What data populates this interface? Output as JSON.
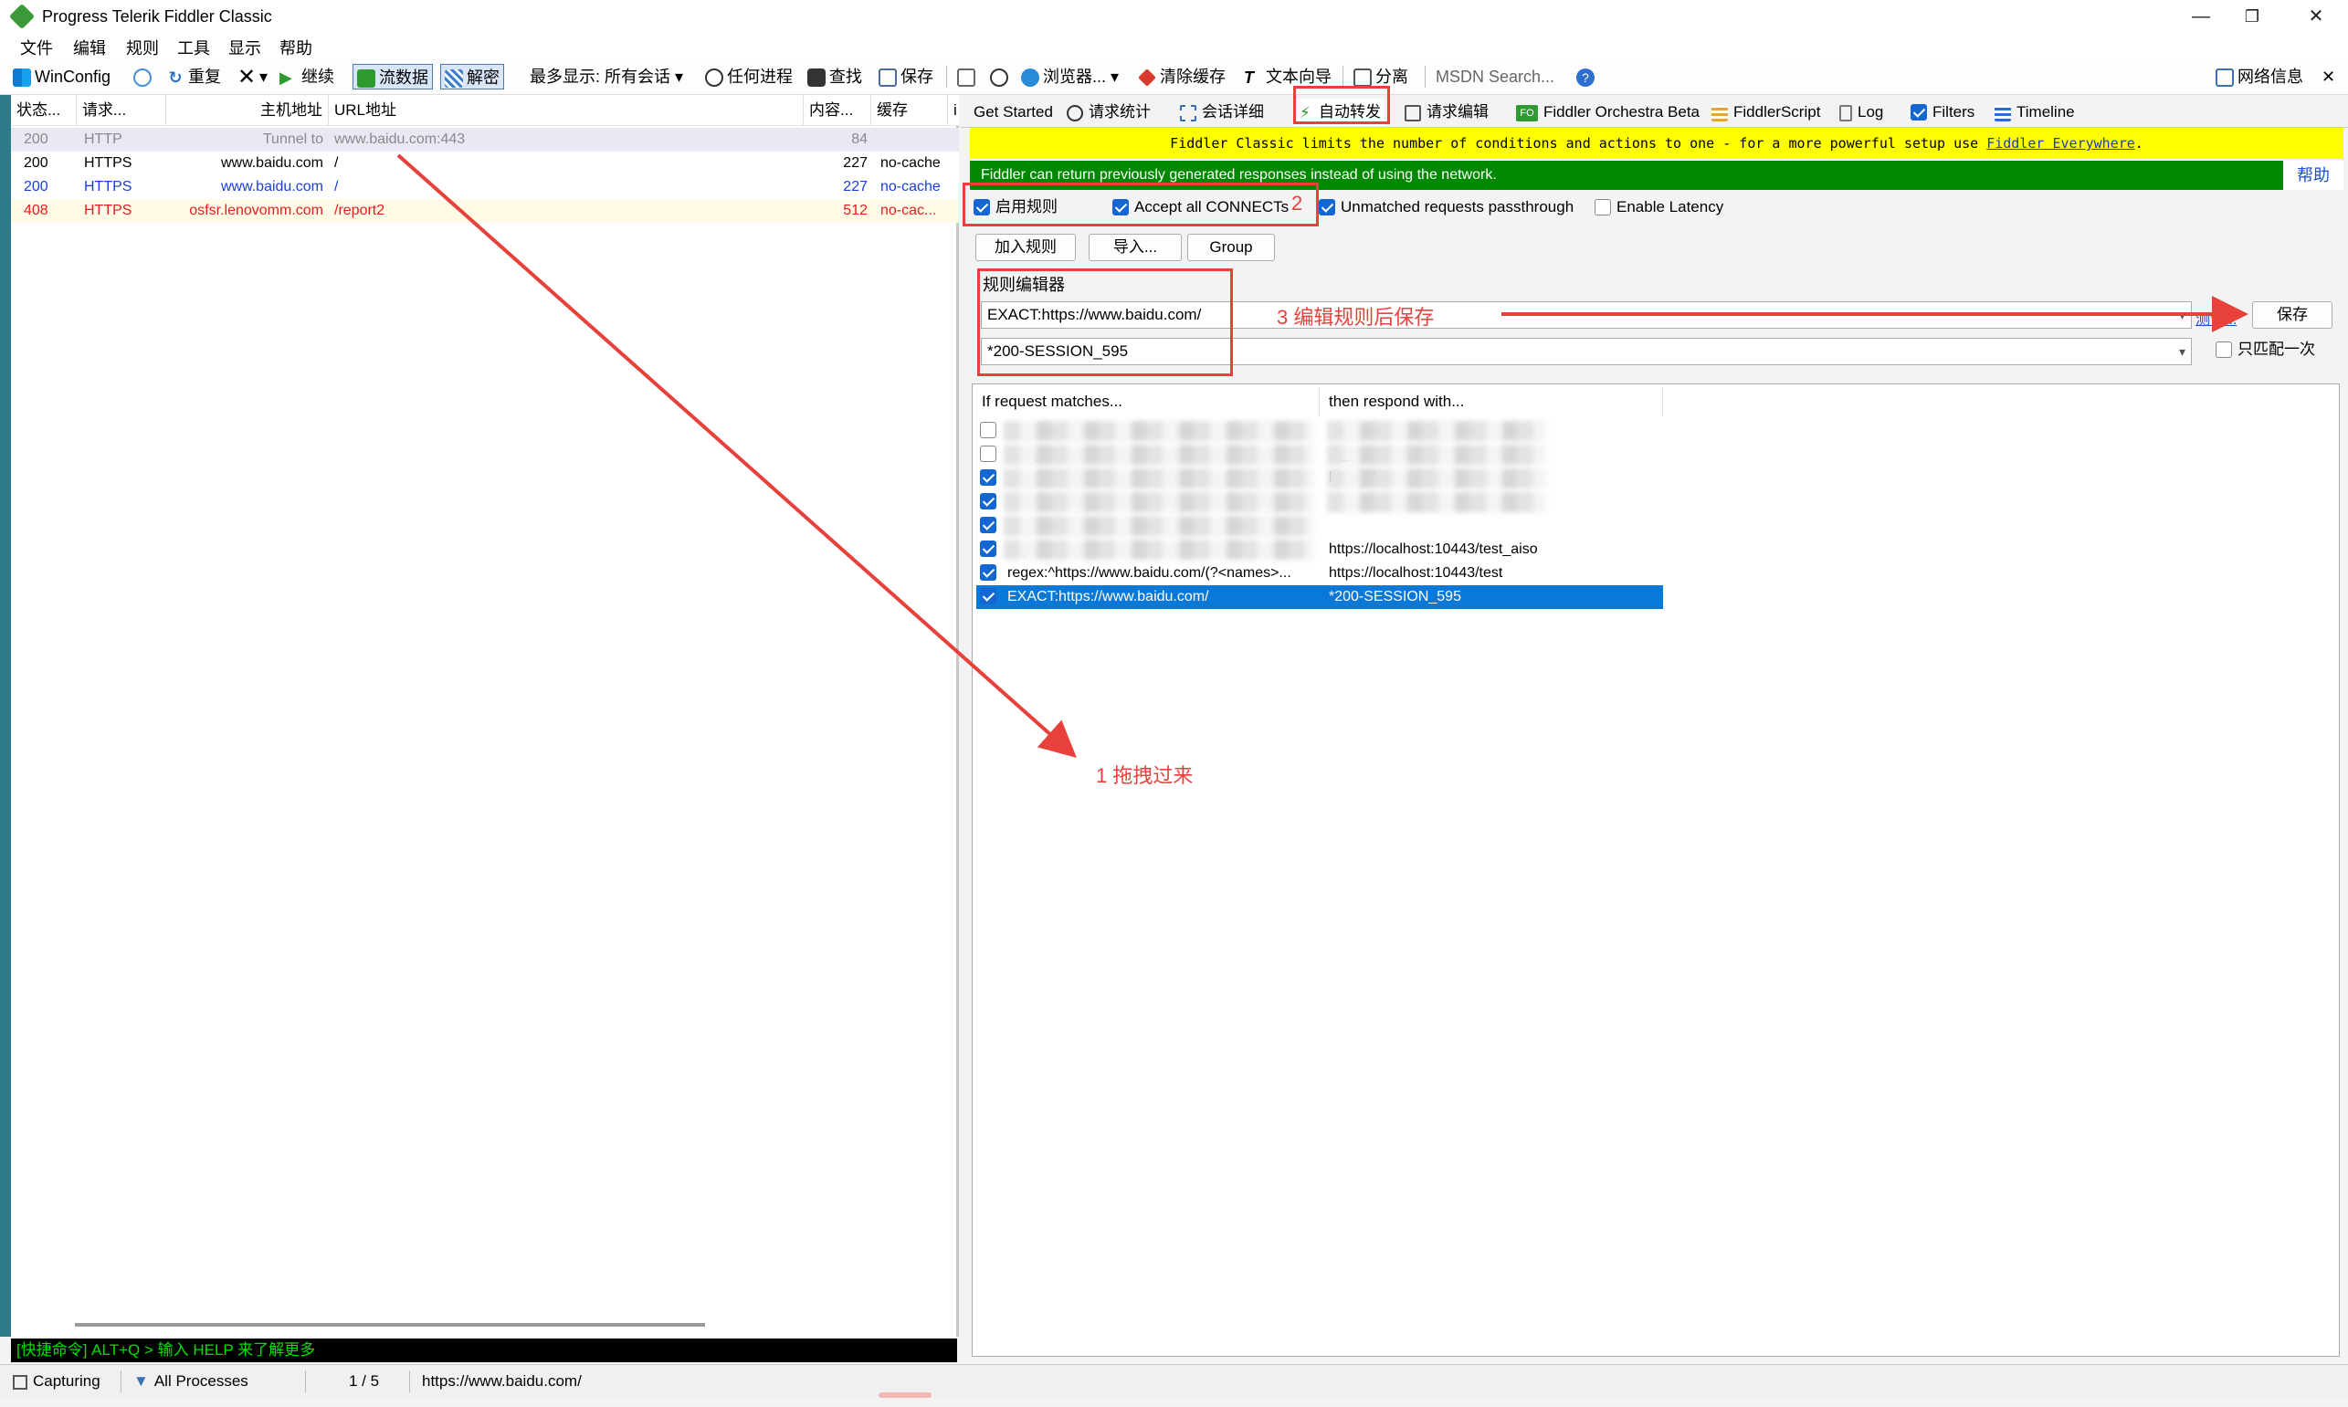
{
  "window": {
    "title": "Progress Telerik Fiddler Classic",
    "minimize": "—",
    "maximize": "❐",
    "close": "✕"
  },
  "menu": [
    "文件",
    "编辑",
    "规则",
    "工具",
    "显示",
    "帮助"
  ],
  "toolbar": {
    "winconfig": "WinConfig",
    "replay": "重复",
    "remove": "▾",
    "resume": "继续",
    "stream": "流数据",
    "decode": "解密",
    "keep_label": "最多显示: 所有会话",
    "process": "任何进程",
    "find": "查找",
    "save": "保存",
    "browse": "浏览器...",
    "clear_cache": "清除缓存",
    "text_wizard": "文本向导",
    "tearoff": "分离",
    "msdn_search": "MSDN Search...",
    "online": "网络信息",
    "close_x": "✕"
  },
  "sessions": {
    "columns": [
      "状态...",
      "请求...",
      "主机地址",
      "URL地址",
      "内容...",
      "缓存",
      "i"
    ],
    "rows": [
      {
        "result": "200",
        "protocol": "HTTP",
        "host": "Tunnel to",
        "url": "www.baidu.com:443",
        "body": "84",
        "cache": "",
        "color": "#8a8a8a",
        "bg": "#e9e9f3"
      },
      {
        "result": "200",
        "protocol": "HTTPS",
        "host": "www.baidu.com",
        "url": "/",
        "body": "227",
        "cache": "no-cache",
        "color": "#000000",
        "bg": "#ffffff"
      },
      {
        "result": "200",
        "protocol": "HTTPS",
        "host": "www.baidu.com",
        "url": "/",
        "body": "227",
        "cache": "no-cache",
        "color": "#1a3fd9",
        "bg": "#ffffff"
      },
      {
        "result": "408",
        "protocol": "HTTPS",
        "host": "osfsr.lenovomm.com",
        "url": "/report2",
        "body": "512",
        "cache": "no-cac...",
        "color": "#e02020",
        "bg": "#fffbe6"
      }
    ]
  },
  "quickexec": "[快捷命令] ALT+Q > 输入 HELP 来了解更多",
  "tabs": [
    "Get Started",
    "请求统计",
    "会话详细",
    "自动转发",
    "请求编辑",
    "Fiddler Orchestra Beta",
    "FiddlerScript",
    "Log",
    "Filters",
    "Timeline"
  ],
  "autoresponder": {
    "notice_text": "Fiddler Classic limits the number of conditions and actions to one - for a more powerful setup use ",
    "notice_link": "Fiddler Everywhere",
    "notice_end": ".",
    "green_text": "Fiddler can return previously generated responses instead of using the network.",
    "help": "帮助",
    "enable_rules": "启用规则",
    "accept_connects": "Accept all CONNECTs",
    "unmatched": "Unmatched requests passthrough",
    "latency": "Enable Latency",
    "add_rule": "加入规则",
    "import": "导入...",
    "group": "Group",
    "editor_label": "规则编辑器",
    "match_value": "EXACT:https://www.baidu.com/",
    "action_value": "*200-SESSION_595",
    "test_link": "测试...",
    "save": "保存",
    "match_once": "只匹配一次",
    "list_headers": [
      "If request matches...",
      "then respond with..."
    ],
    "rules": [
      {
        "match": "",
        "action": "",
        "checked": false,
        "blurred": true
      },
      {
        "match": "...key=",
        "action": "..._ext",
        "checked": false,
        "blurred": true
      },
      {
        "match": "",
        "action": "https://loca...",
        "checked": true,
        "blurred": true
      },
      {
        "match": "",
        "action": "",
        "checked": true,
        "blurred": true
      },
      {
        "match": "",
        "action": "",
        "checked": true,
        "blurred": true
      },
      {
        "match": "regex:...",
        "action": "https://localhost:10443/test_aiso",
        "checked": true,
        "blurred": true
      },
      {
        "match": "regex:^https://www.baidu.com/(?<names>...",
        "action": "https://localhost:10443/test",
        "checked": true,
        "blurred": false
      },
      {
        "match": "EXACT:https://www.baidu.com/",
        "action": "*200-SESSION_595",
        "checked": true,
        "blurred": false,
        "selected": true
      }
    ]
  },
  "statusbar": {
    "capturing": "Capturing",
    "processes": "All Processes",
    "count": "1 / 5",
    "url": "https://www.baidu.com/"
  },
  "annotations": {
    "a1": "1  拖拽过来",
    "a2": "2",
    "a3": "3  编辑规则后保存"
  },
  "colors": {
    "accent_red": "#e8413c",
    "select_blue": "#0a78d7",
    "notice_yellow": "#ffff00",
    "notice_green": "#008800"
  }
}
